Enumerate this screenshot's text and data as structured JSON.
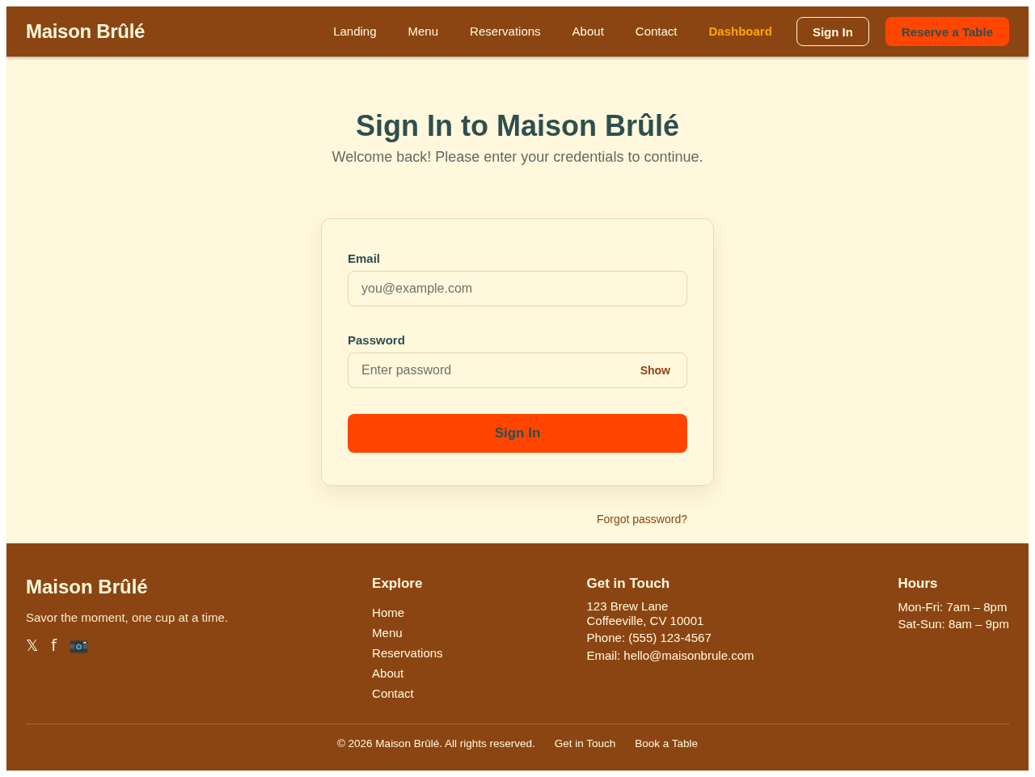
{
  "header": {
    "logo": "Maison Brûlé",
    "nav": [
      {
        "label": "Landing",
        "selected": false
      },
      {
        "label": "Menu",
        "selected": false
      },
      {
        "label": "Reservations",
        "selected": false
      },
      {
        "label": "About",
        "selected": false
      },
      {
        "label": "Contact",
        "selected": false
      },
      {
        "label": "Dashboard",
        "selected": true
      }
    ],
    "buttons": [
      {
        "kind": "outline",
        "label": "Sign In"
      },
      {
        "kind": "primary",
        "label": "Reserve a Table"
      }
    ]
  },
  "hero": {
    "title": "Sign In to Maison Brûlé",
    "subtitle": "Welcome back! Please enter your credentials to continue."
  },
  "form": {
    "fields": [
      {
        "kind": "email",
        "label": "Email",
        "placeholder": "you@example.com"
      },
      {
        "kind": "password",
        "label": "Password",
        "placeholder": "Enter password",
        "toggle": "Show"
      }
    ],
    "submit": "Sign In"
  },
  "forgot_link": "Forgot password?",
  "footer": {
    "brand": {
      "logo": "Maison Brûlé",
      "tagline": "Savor the moment, one cup at a time.",
      "social": [
        {
          "kind": "glyph",
          "text": "𝕏"
        },
        {
          "kind": "glyph",
          "text": "f"
        },
        {
          "kind": "camera"
        }
      ]
    },
    "explore": {
      "heading": "Explore",
      "links": [
        "Home",
        "Menu",
        "Reservations",
        "About",
        "Contact"
      ]
    },
    "contact": {
      "heading": "Get in Touch",
      "address_lines": [
        "123 Brew Lane",
        "Coffeeville, CV 10001"
      ],
      "phone": "Phone: (555) 123-4567",
      "email": "Email: hello@maisonbrule.com"
    },
    "hours": {
      "heading": "Hours",
      "lines": [
        "Mon-Fri: 7am – 8pm",
        "Sat-Sun: 8am – 9pm"
      ]
    },
    "bottom": {
      "copyright": "© 2026 Maison Brûlé. All rights reserved.",
      "links": [
        "Get in Touch",
        "Book a Table"
      ]
    }
  }
}
